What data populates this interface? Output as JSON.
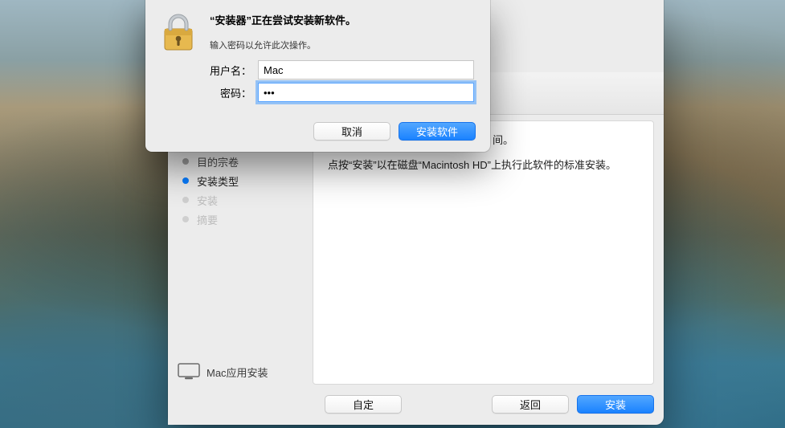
{
  "auth": {
    "title": "“安装器”正在尝试安装新软件。",
    "subtitle": "输入密码以允许此次操作。",
    "username_label": "用户名：",
    "password_label": "密码：",
    "username_value": "Mac",
    "password_value": "•••",
    "cancel_label": "取消",
    "confirm_label": "安装软件"
  },
  "installer": {
    "steps": {
      "dest": "目的宗卷",
      "type": "安装类型",
      "install": "安装",
      "summary": "摘要"
    },
    "content_line1_tail": "间。",
    "content_line2": "点按“安装”以在磁盘“Macintosh HD”上执行此软件的标准安装。",
    "footer_title": "Mac应用安装",
    "customize_label": "自定",
    "back_label": "返回",
    "install_label": "安装"
  }
}
